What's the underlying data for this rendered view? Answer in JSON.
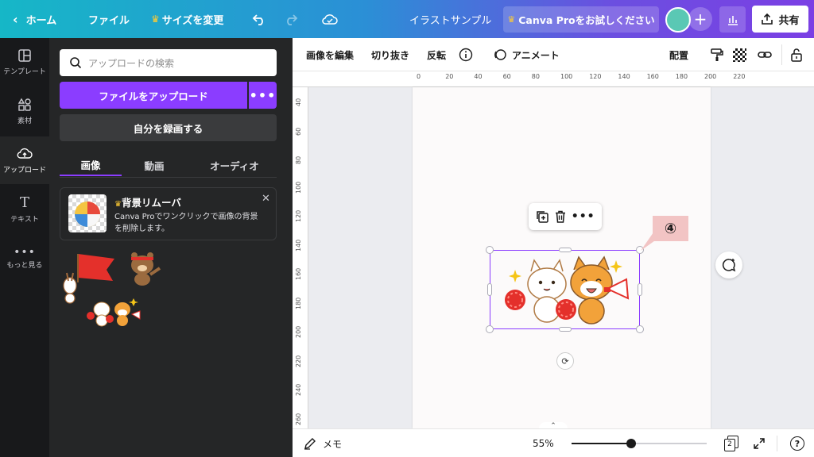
{
  "topbar": {
    "home": "ホーム",
    "file": "ファイル",
    "resize": "サイズを変更",
    "doc_title": "イラストサンプル",
    "pro_trial": "Canva Proをお試しください",
    "share": "共有"
  },
  "rail": [
    {
      "label": "テンプレート",
      "icon": "template-icon"
    },
    {
      "label": "素材",
      "icon": "elements-icon"
    },
    {
      "label": "アップロード",
      "icon": "upload-icon"
    },
    {
      "label": "テキスト",
      "icon": "text-icon"
    },
    {
      "label": "もっと見る",
      "icon": "more-icon"
    }
  ],
  "panel": {
    "search_placeholder": "アップロードの検索",
    "upload_button": "ファイルをアップロード",
    "more_button": "•••",
    "record_button": "自分を録画する",
    "tabs": [
      "画像",
      "動画",
      "オーディオ"
    ],
    "promo": {
      "title": "背景リムーバ",
      "description": "Canva Proでワンクリックで画像の背景を削除します。"
    }
  },
  "ctxbar": {
    "edit_image": "画像を編集",
    "crop": "切り抜き",
    "flip": "反転",
    "animate": "アニメート",
    "position": "配置"
  },
  "ruler": {
    "h_ticks": [
      "0",
      "20",
      "40",
      "60",
      "80",
      "100",
      "120",
      "140",
      "160",
      "180",
      "200",
      "220"
    ],
    "v_ticks": [
      "40",
      "60",
      "80",
      "100",
      "120",
      "140",
      "160",
      "180",
      "200",
      "220",
      "240",
      "260"
    ]
  },
  "annotation": "④",
  "bottombar": {
    "notes": "メモ",
    "zoom": "55%",
    "zoom_fraction": 0.44,
    "page_count": "2",
    "help": "?"
  },
  "colors": {
    "accent": "#8b3dff",
    "panel_bg": "#252627",
    "rail_bg": "#18191b"
  }
}
